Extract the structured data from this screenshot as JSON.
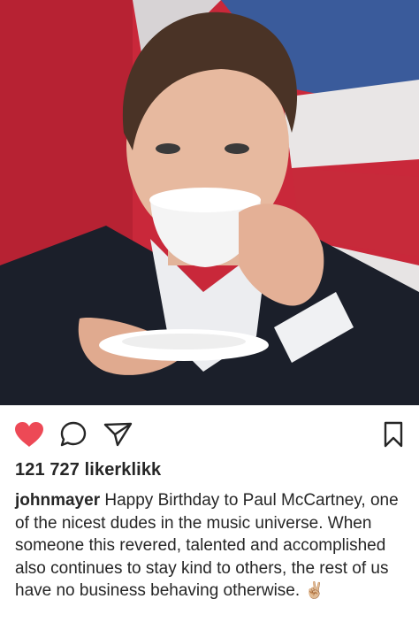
{
  "post": {
    "photo": {
      "description_icon": "photo",
      "colors": {
        "flag_red": "#c9283a",
        "flag_blue": "#3a5b9b",
        "jacket": "#1b1f2a"
      }
    },
    "actions": {
      "like_icon": "heart-filled-icon",
      "comment_icon": "comment-icon",
      "share_icon": "paper-plane-icon",
      "save_icon": "bookmark-icon",
      "like_color": "#ed4956"
    },
    "likes_text": "121 727 likerklikk",
    "caption": {
      "username": "johnmayer",
      "text": "Happy Birthday to Paul McCartney, one of the nicest dudes in the music universe. When someone this revered, talented and accomplished also continues to stay kind to others, the rest of us have no business behaving otherwise.",
      "emoji": "✌🏼"
    }
  }
}
